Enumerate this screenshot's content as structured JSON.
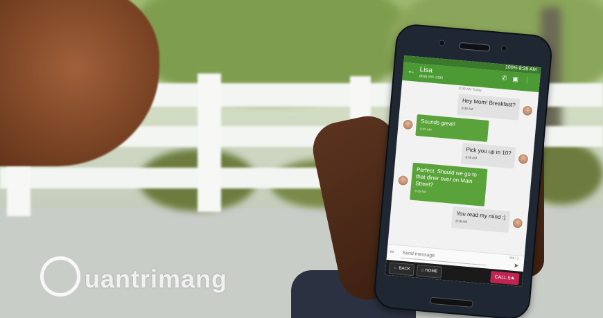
{
  "status_bar": {
    "battery": "100%",
    "time": "8:39 AM"
  },
  "app_bar": {
    "contact_name": "Lisa",
    "contact_phone": "(858) 555-1283"
  },
  "conversation": {
    "timestamp": "8:39 AM Today",
    "messages": [
      {
        "direction": "out",
        "text": "Hey Mom! Breakfast?",
        "time": "8:35 AM"
      },
      {
        "direction": "in",
        "text": "Sounds great!",
        "time": "8:35 AM"
      },
      {
        "direction": "out",
        "text": "Pick you up in 10?",
        "time": "8:36 AM"
      },
      {
        "direction": "in",
        "text": "Perfect. Should we go to that diner over on Main Street?",
        "time": "8:36 AM"
      },
      {
        "direction": "out",
        "text": "You read my mind :)",
        "time": "8:39 AM"
      }
    ]
  },
  "composer": {
    "placeholder": "Send message",
    "counter": "160 / 1"
  },
  "nav_buttons": {
    "back": "BACK",
    "home": "HOME",
    "call": "CALL 5★"
  },
  "watermark": {
    "text": "uantrimang"
  },
  "icons": [
    "back-arrow-icon",
    "phone-icon",
    "contact-card-icon",
    "overflow-menu-icon",
    "attach-icon",
    "send-icon",
    "home-icon",
    "quantrimang-logo-icon"
  ],
  "colors": {
    "app_bar": "#4c9a33",
    "incoming_bubble": "#5aa33a",
    "call_button": "#c02452"
  }
}
